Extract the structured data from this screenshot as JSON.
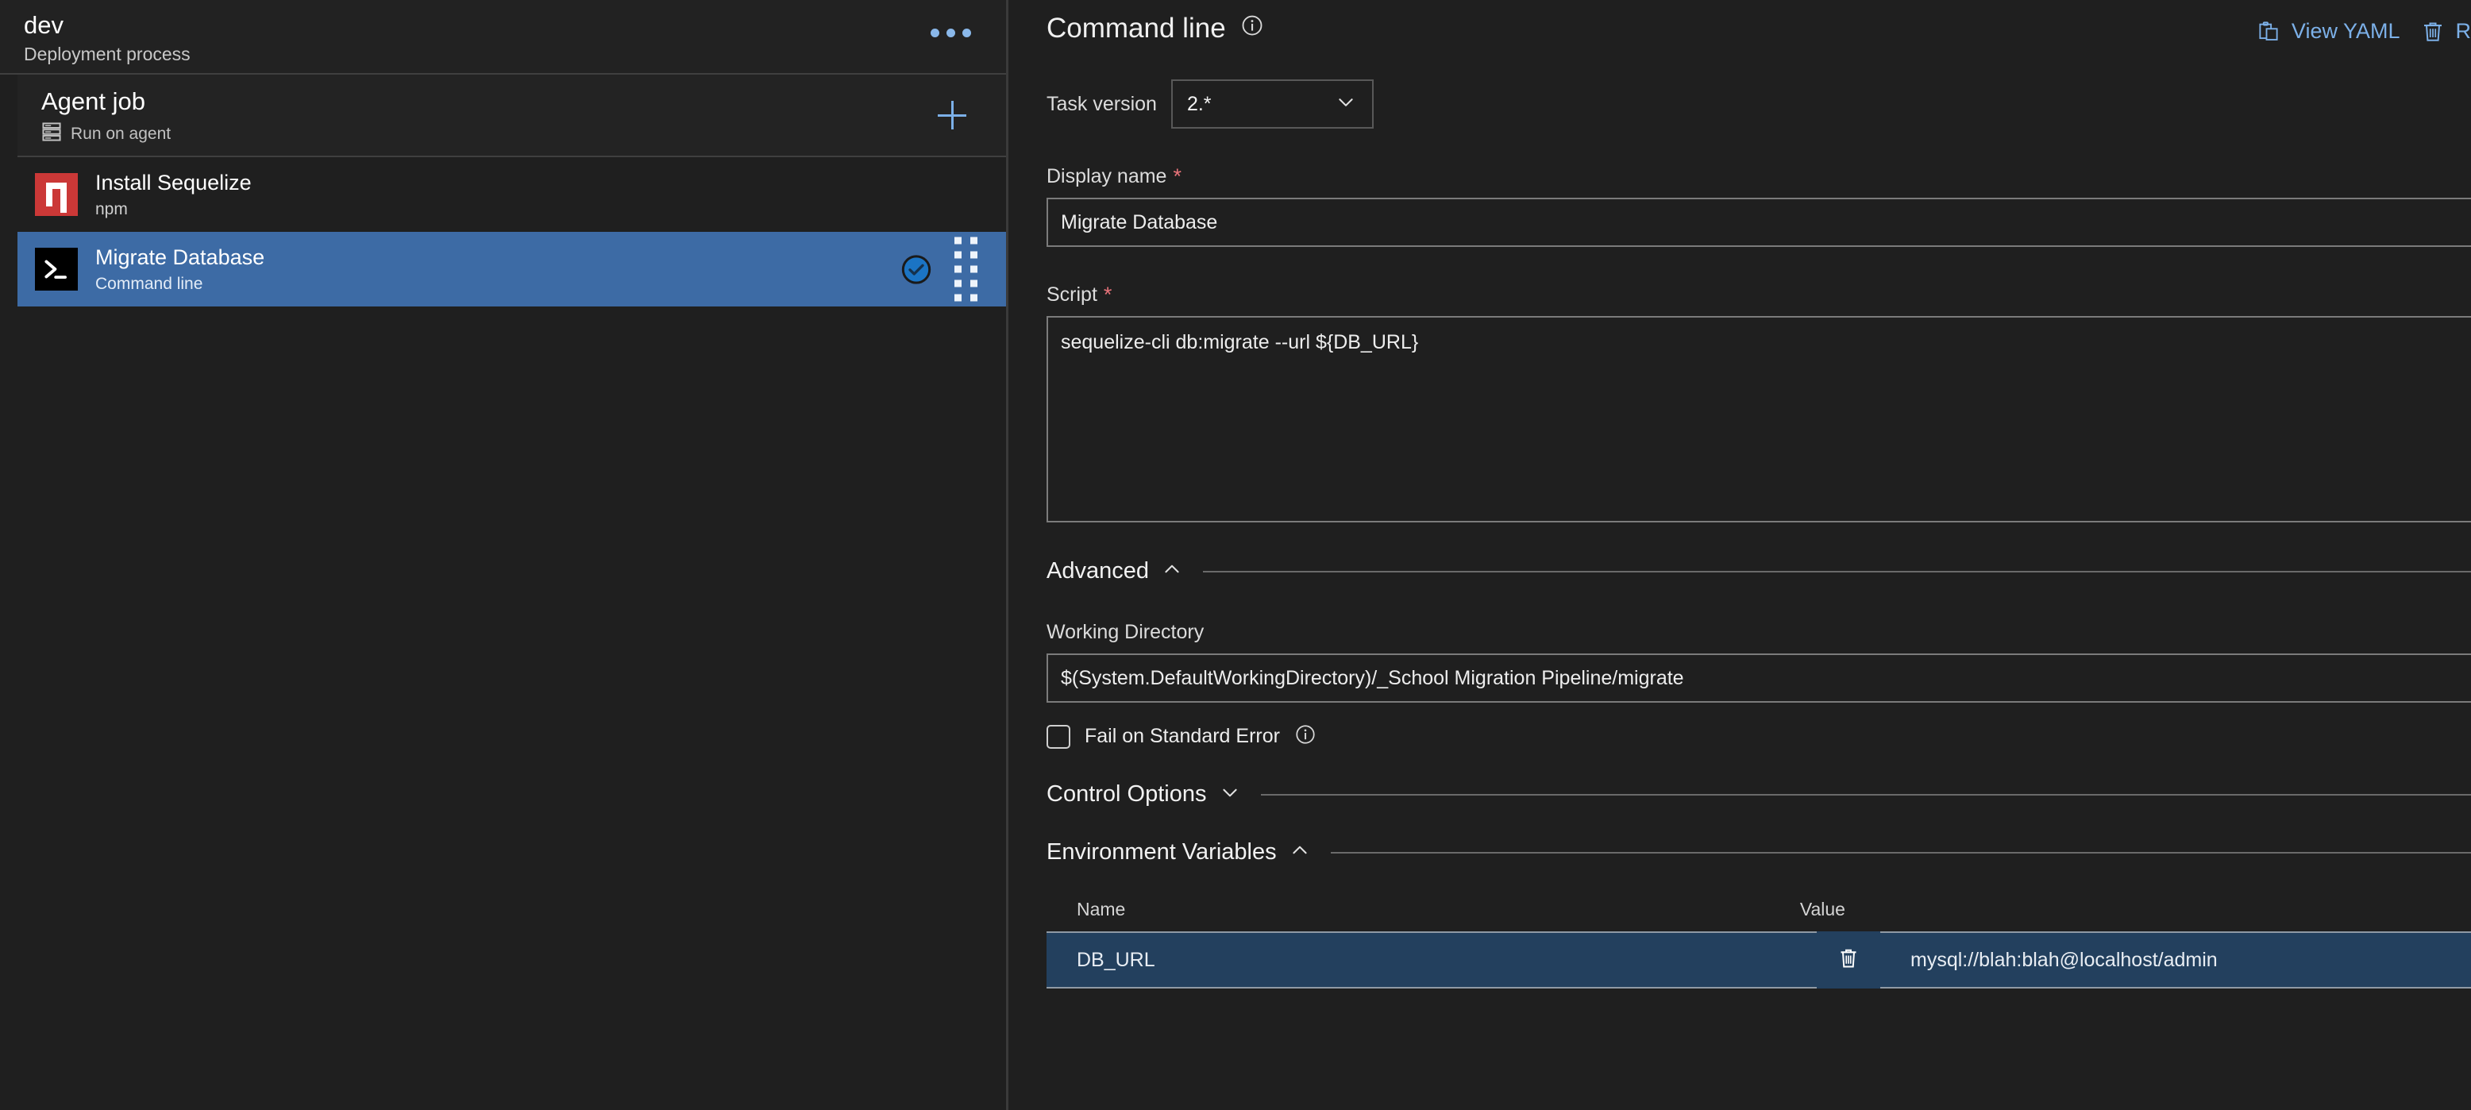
{
  "sidebar": {
    "header": {
      "title": "dev",
      "subtitle": "Deployment process",
      "more_label": "more-options"
    },
    "job": {
      "title": "Agent job",
      "subtitle": "Run on agent",
      "add_label": "+"
    },
    "tasks": [
      {
        "name": "Install Sequelize",
        "subtitle": "npm",
        "icon": "npm-icon",
        "selected": false
      },
      {
        "name": "Migrate Database",
        "subtitle": "Command line",
        "icon": "command-line-icon",
        "selected": true
      }
    ]
  },
  "panel": {
    "title": "Command line",
    "info_icon": "info-icon",
    "actions": [
      {
        "label": "View YAML",
        "icon": "clipboard-icon"
      },
      {
        "label": "R",
        "icon": "trash-icon"
      }
    ],
    "task_version": {
      "label": "Task version",
      "value": "2.*",
      "chevron": "chevron-down-icon"
    },
    "display_name": {
      "label": "Display name",
      "required": "*",
      "value": "Migrate Database"
    },
    "script": {
      "label": "Script",
      "required": "*",
      "value": "sequelize-cli db:migrate --url ${DB_URL}"
    },
    "advanced": {
      "label": "Advanced",
      "chevron": "chevron-up-icon",
      "working_directory": {
        "label": "Working Directory",
        "value": "$(System.DefaultWorkingDirectory)/_School Migration Pipeline/migrate"
      },
      "fail_on_stderr": {
        "label": "Fail on Standard Error",
        "checked": false,
        "info_icon": "info-icon"
      }
    },
    "control_options": {
      "label": "Control Options",
      "chevron": "chevron-down-icon"
    },
    "environment_variables": {
      "label": "Environment Variables",
      "chevron": "chevron-up-icon",
      "columns": {
        "name": "Name",
        "value": "Value"
      },
      "rows": [
        {
          "name": "DB_URL",
          "value": "mysql://blah:blah@localhost/admin",
          "delete_icon": "trash-icon"
        }
      ]
    }
  },
  "colors": {
    "accent_blue": "#7cb0e8",
    "selected_row": "#3d6ba5",
    "env_row": "#23405e",
    "npm_red": "#cb3837",
    "required_red": "#e8737a",
    "background": "#1f1f1f"
  }
}
